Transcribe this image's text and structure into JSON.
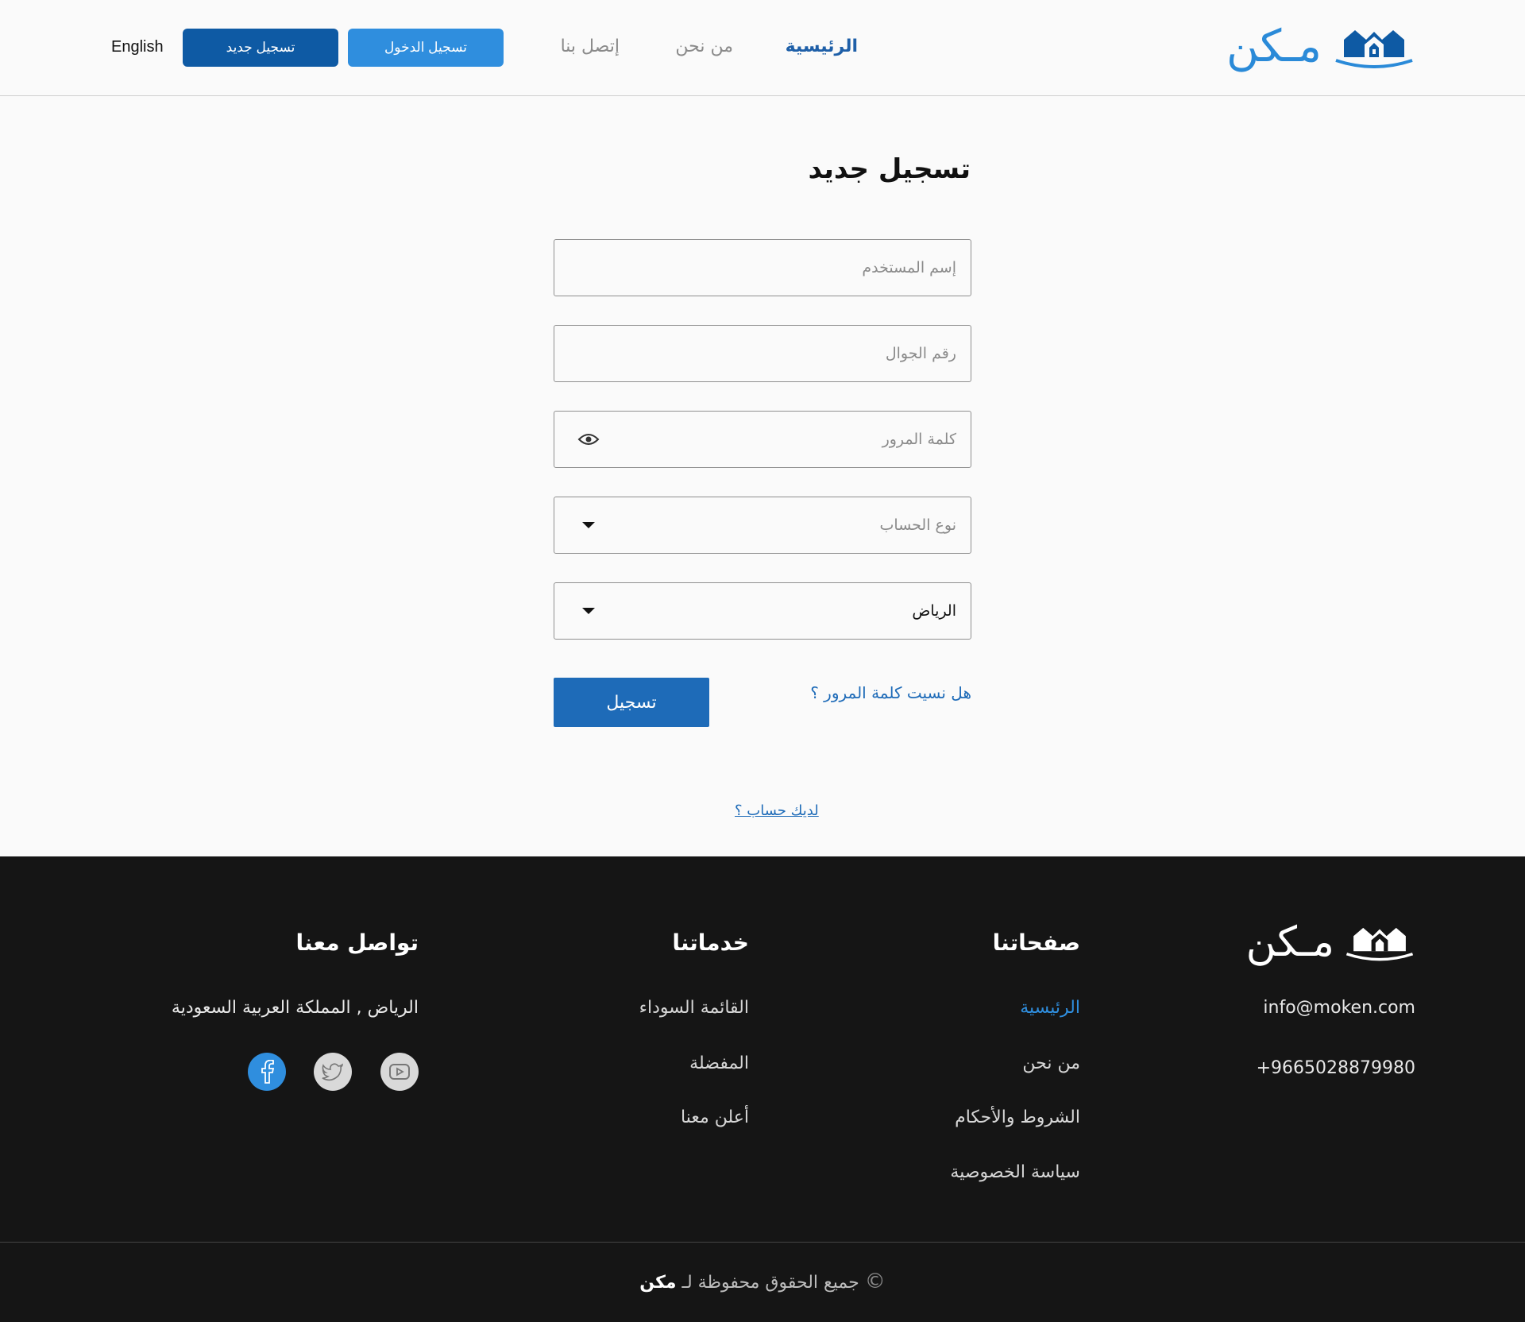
{
  "header": {
    "brand": "مـكن",
    "nav": {
      "home": "الرئيسية",
      "about": "من نحن",
      "contact": "إتصل بنا"
    },
    "login_label": "تسجيل الدخول",
    "register_label": "تسجيل جديد",
    "language_label": "English"
  },
  "form": {
    "title": "تسجيل جديد",
    "username_placeholder": "إسم المستخدم",
    "mobile_placeholder": "رقم الجوال",
    "password_placeholder": "كلمة المرور",
    "account_type_placeholder": "نوع الحساب",
    "city_value": "الرياض",
    "submit_label": "تسجيل",
    "forgot_password": "هل نسيت كلمة المرور ؟",
    "have_account": "لديك حساب ؟"
  },
  "footer": {
    "brand": "مـكن",
    "email": "info@moken.com",
    "phone": "+9665028879980",
    "pages_title": "صفحاتنا",
    "pages": [
      "الرئيسية",
      "من نحن",
      "الشروط والأحكام",
      "سياسة الخصوصية"
    ],
    "services_title": "خدماتنا",
    "services": [
      "القائمة السوداء",
      "المفضلة",
      "أعلن معنا"
    ],
    "contact_title": "تواصل معنا",
    "address": "الرياض , المملكة العربية السعودية",
    "copyright_text": "جميع الحقوق محفوظة لـ",
    "copyright_brand": "مكن",
    "copyright_symbol": "©"
  },
  "colors": {
    "accent": "#2f8ede",
    "primary_dark": "#0e5aa4",
    "link": "#1e6bb8",
    "footer_bg": "#151515",
    "facebook": "#2f8ede",
    "social_muted": "#d9d9d9"
  },
  "icons": {
    "logo": "house-icon",
    "password_toggle": "eye-icon",
    "dropdown": "caret-down-icon",
    "social": [
      "facebook-icon",
      "twitter-icon",
      "youtube-icon"
    ]
  }
}
